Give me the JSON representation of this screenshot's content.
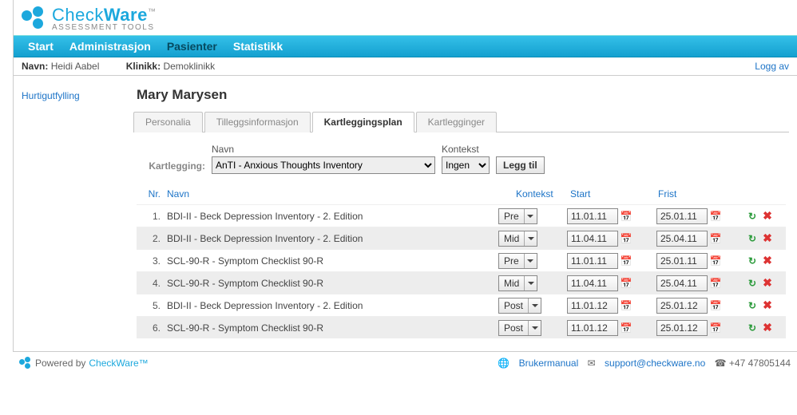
{
  "brand": {
    "name": "CheckWare",
    "subtitle": "ASSESSMENT TOOLS",
    "tm": "™"
  },
  "nav": {
    "items": [
      "Start",
      "Administrasjon",
      "Pasienter",
      "Statistikk"
    ],
    "active_index": 2
  },
  "infobar": {
    "name_label": "Navn:",
    "name_value": "Heidi Aabel",
    "clinic_label": "Klinikk:",
    "clinic_value": "Demoklinikk",
    "logoff": "Logg av"
  },
  "sidebar": {
    "quickfill": "Hurtigutfylling"
  },
  "page": {
    "title": "Mary Marysen",
    "tabs": [
      "Personalia",
      "Tilleggsinformasjon",
      "Kartleggingsplan",
      "Kartlegginger"
    ],
    "active_tab": 2
  },
  "form": {
    "row_label": "Kartlegging:",
    "name_label": "Navn",
    "name_value": "AnTI - Anxious Thoughts Inventory",
    "context_label": "Kontekst",
    "context_value": "Ingen",
    "add_button": "Legg til"
  },
  "table": {
    "headers": {
      "nr": "Nr.",
      "name": "Navn",
      "context": "Kontekst",
      "start": "Start",
      "end": "Frist"
    },
    "rows": [
      {
        "nr": "1.",
        "name": "BDI-II - Beck Depression Inventory - 2. Edition",
        "context": "Pre",
        "start": "11.01.11",
        "end": "25.01.11"
      },
      {
        "nr": "2.",
        "name": "BDI-II - Beck Depression Inventory - 2. Edition",
        "context": "Mid",
        "start": "11.04.11",
        "end": "25.04.11"
      },
      {
        "nr": "3.",
        "name": "SCL-90-R - Symptom Checklist 90-R",
        "context": "Pre",
        "start": "11.01.11",
        "end": "25.01.11"
      },
      {
        "nr": "4.",
        "name": "SCL-90-R - Symptom Checklist 90-R",
        "context": "Mid",
        "start": "11.04.11",
        "end": "25.04.11"
      },
      {
        "nr": "5.",
        "name": "BDI-II - Beck Depression Inventory - 2. Edition",
        "context": "Post",
        "start": "11.01.12",
        "end": "25.01.12"
      },
      {
        "nr": "6.",
        "name": "SCL-90-R - Symptom Checklist 90-R",
        "context": "Post",
        "start": "11.01.12",
        "end": "25.01.12"
      }
    ]
  },
  "footer": {
    "powered": "Powered by",
    "brand": "CheckWare™",
    "manual": "Brukermanual",
    "support": "support@checkware.no",
    "phone": "+47 47805144"
  }
}
